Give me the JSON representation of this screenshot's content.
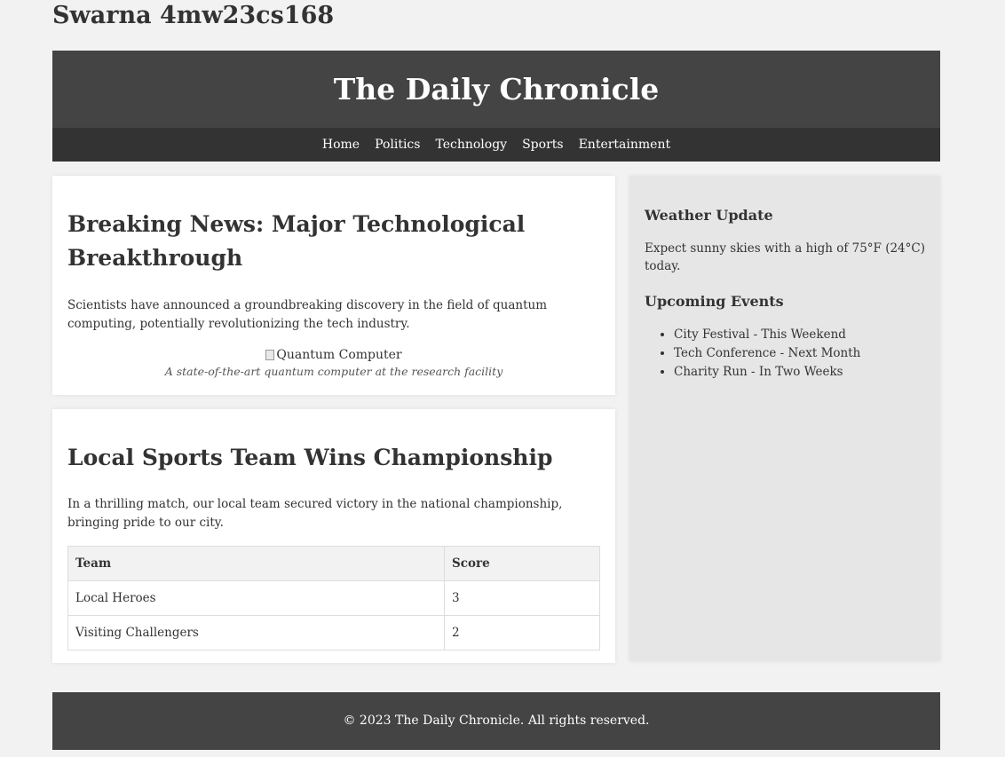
{
  "page": {
    "top_name": "Swarna 4mw23cs168"
  },
  "header": {
    "title": "The Daily Chronicle"
  },
  "nav": {
    "items": [
      "Home",
      "Politics",
      "Technology",
      "Sports",
      "Entertainment"
    ]
  },
  "articles": [
    {
      "title": "Breaking News: Major Technological Breakthrough",
      "body": "Scientists have announced a groundbreaking discovery in the field of quantum computing, potentially revolutionizing the tech industry.",
      "image_alt": "Quantum Computer",
      "caption": "A state-of-the-art quantum computer at the research facility"
    },
    {
      "title": "Local Sports Team Wins Championship",
      "body": "In a thrilling match, our local team secured victory in the national championship, bringing pride to our city.",
      "table": {
        "headers": [
          "Team",
          "Score"
        ],
        "rows": [
          [
            "Local Heroes",
            "3"
          ],
          [
            "Visiting Challengers",
            "2"
          ]
        ]
      }
    }
  ],
  "sidebar": {
    "weather_title": "Weather Update",
    "weather_text": "Expect sunny skies with a high of 75°F (24°C) today.",
    "events_title": "Upcoming Events",
    "events": [
      "City Festival - This Weekend",
      "Tech Conference - Next Month",
      "Charity Run - In Two Weeks"
    ]
  },
  "footer": {
    "text": "© 2023 The Daily Chronicle. All rights reserved."
  },
  "colors": {
    "page_bg": "#f2f2f2",
    "header_bg": "#444444",
    "nav_bg": "#333333",
    "sidebar_bg": "#e6e6e6",
    "card_bg": "#ffffff"
  }
}
